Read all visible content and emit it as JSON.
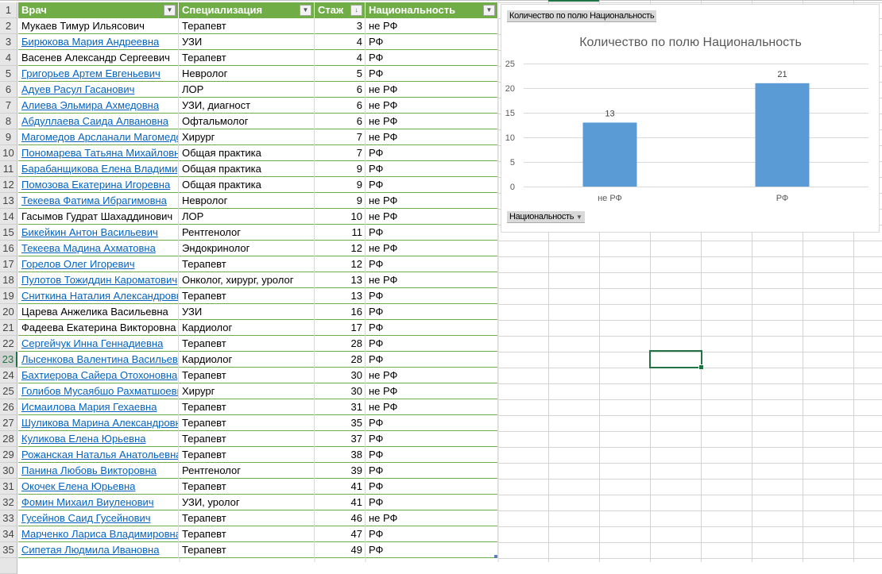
{
  "sheet": {
    "columns": [
      "Врач",
      "Специализация",
      "Стаж",
      "Национальность"
    ],
    "rows": [
      {
        "n": 2,
        "name": "Мукаев Тимур Ильясович",
        "spec": "Терапевт",
        "exp": 3,
        "nat": "не РФ",
        "link": false
      },
      {
        "n": 3,
        "name": "Бирюкова Мария Андреевна",
        "spec": "УЗИ",
        "exp": 4,
        "nat": "РФ",
        "link": true
      },
      {
        "n": 4,
        "name": "Васенев Александр Сергеевич",
        "spec": "Терапевт",
        "exp": 4,
        "nat": "РФ",
        "link": false
      },
      {
        "n": 5,
        "name": "Григорьев Артем Евгеньевич",
        "spec": "Невролог",
        "exp": 5,
        "nat": "РФ",
        "link": true
      },
      {
        "n": 6,
        "name": "Адуев Расул Гасанович",
        "spec": "ЛОР",
        "exp": 6,
        "nat": "не РФ",
        "link": true
      },
      {
        "n": 7,
        "name": "Алиева Эльмира Ахмедовна",
        "spec": "УЗИ, диагност",
        "exp": 6,
        "nat": "не РФ",
        "link": true
      },
      {
        "n": 8,
        "name": "Абдуллаева Саида Алвановна",
        "spec": "Офтальмолог",
        "exp": 6,
        "nat": "не РФ",
        "link": true
      },
      {
        "n": 9,
        "name": "Магомедов Арсланали Магомедович",
        "spec": "Хирург",
        "exp": 7,
        "nat": "не РФ",
        "link": true
      },
      {
        "n": 10,
        "name": "Пономарева Татьяна Михайловна",
        "spec": "Общая практика",
        "exp": 7,
        "nat": "РФ",
        "link": true
      },
      {
        "n": 11,
        "name": "Барабанщикова Елена Владимировна",
        "spec": "Общая практика",
        "exp": 9,
        "nat": "РФ",
        "link": true
      },
      {
        "n": 12,
        "name": "Помозова Екатерина Игоревна",
        "spec": "Общая практика",
        "exp": 9,
        "nat": "РФ",
        "link": true
      },
      {
        "n": 13,
        "name": "Текеева Фатима Ибрагимовна",
        "spec": "Невролог",
        "exp": 9,
        "nat": "не РФ",
        "link": true
      },
      {
        "n": 14,
        "name": "Гасымов Гудрат Шахаддинович",
        "spec": "ЛОР",
        "exp": 10,
        "nat": "не РФ",
        "link": false
      },
      {
        "n": 15,
        "name": "Бикейкин Антон Васильевич",
        "spec": "Рентгенолог",
        "exp": 11,
        "nat": "РФ",
        "link": true
      },
      {
        "n": 16,
        "name": "Текеева Мадина Ахматовна",
        "spec": "Эндокринолог",
        "exp": 12,
        "nat": "не РФ",
        "link": true
      },
      {
        "n": 17,
        "name": "Горелов Олег Игоревич",
        "spec": "Терапевт",
        "exp": 12,
        "nat": "РФ",
        "link": true
      },
      {
        "n": 18,
        "name": "Пулотов Тожиддин Кароматович",
        "spec": "Онколог, хирург, уролог",
        "exp": 13,
        "nat": "не РФ",
        "link": true
      },
      {
        "n": 19,
        "name": "Сниткина Наталия Александровна",
        "spec": "Терапевт",
        "exp": 13,
        "nat": "РФ",
        "link": true
      },
      {
        "n": 20,
        "name": "Царева Анжелика Васильевна",
        "spec": "УЗИ",
        "exp": 16,
        "nat": "РФ",
        "link": false
      },
      {
        "n": 21,
        "name": "Фадеева Екатерина Викторовна",
        "spec": "Кардиолог",
        "exp": 17,
        "nat": "РФ",
        "link": false
      },
      {
        "n": 22,
        "name": "Сергейчук Инна Геннадиевна",
        "spec": "Терапевт",
        "exp": 28,
        "nat": "РФ",
        "link": true
      },
      {
        "n": 23,
        "name": "Лысенкова Валентина Васильевна",
        "spec": "Кардиолог",
        "exp": 28,
        "nat": "РФ",
        "link": true
      },
      {
        "n": 24,
        "name": "Бахтиерова Сайера Отохоновна",
        "spec": "Терапевт",
        "exp": 30,
        "nat": "не РФ",
        "link": true
      },
      {
        "n": 25,
        "name": "Голибов Мусаябшо Рахматшоевич",
        "spec": "Хирург",
        "exp": 30,
        "nat": "не РФ",
        "link": true
      },
      {
        "n": 26,
        "name": "Исмаилова Мария Гехаевна",
        "spec": "Терапевт",
        "exp": 31,
        "nat": "не РФ",
        "link": true
      },
      {
        "n": 27,
        "name": "Шуликова Марина Александровна",
        "spec": "Терапевт",
        "exp": 35,
        "nat": "РФ",
        "link": true
      },
      {
        "n": 28,
        "name": "Куликова Елена Юрьевна",
        "spec": "Терапевт",
        "exp": 37,
        "nat": "РФ",
        "link": true
      },
      {
        "n": 29,
        "name": "Рожанская Наталья Анатольевна",
        "spec": "Терапевт",
        "exp": 38,
        "nat": "РФ",
        "link": true
      },
      {
        "n": 30,
        "name": "Панина Любовь Викторовна",
        "spec": "Рентгенолог",
        "exp": 39,
        "nat": "РФ",
        "link": true
      },
      {
        "n": 31,
        "name": "Окочек Елена Юрьевна",
        "spec": "Терапевт",
        "exp": 41,
        "nat": "РФ",
        "link": true
      },
      {
        "n": 32,
        "name": "Фомин Михаил Виуленович",
        "spec": "УЗИ, уролог",
        "exp": 41,
        "nat": "РФ",
        "link": true
      },
      {
        "n": 33,
        "name": "Гусейнов Саид Гусейнович",
        "spec": "Терапевт",
        "exp": 46,
        "nat": "не РФ",
        "link": true
      },
      {
        "n": 34,
        "name": "Марченко Лариса Владимировна",
        "spec": "Терапевт",
        "exp": 47,
        "nat": "РФ",
        "link": true
      },
      {
        "n": 35,
        "name": "Сипетая Людмила Ивановна",
        "spec": "Терапевт",
        "exp": 49,
        "nat": "РФ",
        "link": true
      }
    ],
    "selected_row": 23,
    "header_color": "#70ad47",
    "link_color": "#0563c1"
  },
  "pivot": {
    "value_field_button": "Количество по полю Национальность",
    "axis_field_button": "Национальность"
  },
  "chart_data": {
    "type": "bar",
    "title": "Количество по полю Национальность",
    "categories": [
      "не РФ",
      "РФ"
    ],
    "values": [
      13,
      21
    ],
    "ylim": [
      0,
      25
    ],
    "yticks": [
      0,
      5,
      10,
      15,
      20,
      25
    ],
    "grid": true,
    "legend": "none",
    "bar_color": "#5b9bd5"
  }
}
